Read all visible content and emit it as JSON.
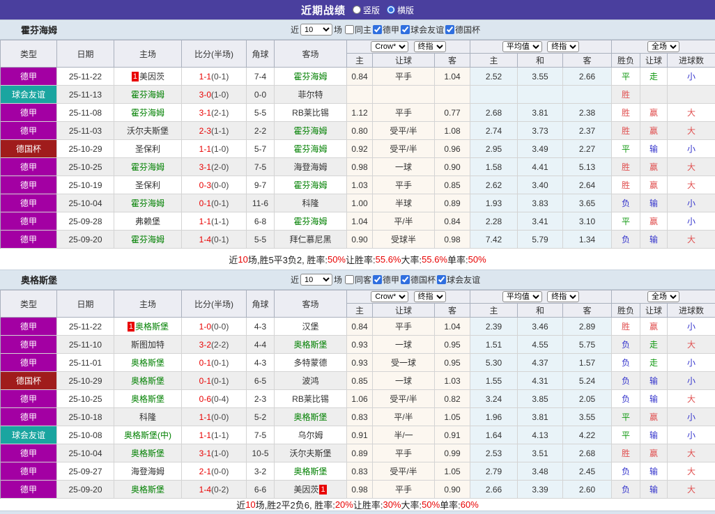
{
  "topbar": {
    "title": "近期战绩",
    "radios": [
      {
        "label": "竖版",
        "checked": false
      },
      {
        "label": "横版",
        "checked": true
      }
    ]
  },
  "colors": {
    "topbar_bg": "#4a3f9e",
    "league_badge": "#a300a3",
    "friendly_badge": "#1aa5a0",
    "cup_badge": "#a01c1c",
    "team_highlight_green": "#008000",
    "score_red": "#e80000",
    "result_red": "#e05050",
    "result_blue": "#3333cc",
    "result_green": "#119911",
    "odds_col_bg": "#fcf7f0",
    "avg_col_bg": "#e9f3f8",
    "strip_bg": "#dce6ef"
  },
  "columns": {
    "left": [
      "类型",
      "日期",
      "主场",
      "比分(半场)",
      "角球",
      "客场"
    ],
    "odds_selects": [
      "Crow*",
      "终指"
    ],
    "avg_selects": [
      "平均值",
      "终指"
    ],
    "scope_select": "全场",
    "sub": [
      "主",
      "让球",
      "客",
      "主",
      "和",
      "客",
      "胜负",
      "让球",
      "进球数"
    ]
  },
  "sections": [
    {
      "team": "霍芬海姆",
      "filter": {
        "prefix": "近",
        "count": "10",
        "suffix": "场",
        "checkboxes": [
          {
            "label": "同主",
            "checked": false
          },
          {
            "label": "德甲",
            "checked": true
          },
          {
            "label": "球会友谊",
            "checked": true
          },
          {
            "label": "德国杯",
            "checked": true
          }
        ]
      },
      "rows": [
        {
          "type": "德甲",
          "kind": "league",
          "date": "25-11-22",
          "home": {
            "name": "美因茨",
            "green": false,
            "badge": "1"
          },
          "score": "1-1",
          "half": "(0-1)",
          "corners": "7-4",
          "away": {
            "name": "霍芬海姆",
            "green": true
          },
          "odds": [
            "0.84",
            "平手",
            "1.04"
          ],
          "avg": [
            "2.52",
            "3.55",
            "2.66"
          ],
          "res": [
            [
              "平",
              "g"
            ],
            [
              "走",
              "g"
            ],
            [
              "小",
              "b"
            ]
          ]
        },
        {
          "type": "球会友谊",
          "kind": "friendly",
          "date": "25-11-13",
          "home": {
            "name": "霍芬海姆",
            "green": true
          },
          "score": "3-0",
          "half": "(1-0)",
          "corners": "0-0",
          "away": {
            "name": "菲尔特",
            "green": false
          },
          "odds": [
            "",
            "",
            ""
          ],
          "avg": [
            "",
            "",
            ""
          ],
          "res": [
            [
              "胜",
              "r"
            ],
            null,
            null
          ]
        },
        {
          "type": "德甲",
          "kind": "league",
          "date": "25-11-08",
          "home": {
            "name": "霍芬海姆",
            "green": true
          },
          "score": "3-1",
          "half": "(2-1)",
          "corners": "5-5",
          "away": {
            "name": "RB莱比锡",
            "green": false
          },
          "odds": [
            "1.12",
            "平手",
            "0.77"
          ],
          "avg": [
            "2.68",
            "3.81",
            "2.38"
          ],
          "res": [
            [
              "胜",
              "r"
            ],
            [
              "赢",
              "r"
            ],
            [
              "大",
              "r"
            ]
          ]
        },
        {
          "type": "德甲",
          "kind": "league",
          "date": "25-11-03",
          "home": {
            "name": "沃尔夫斯堡",
            "green": false
          },
          "score": "2-3",
          "half": "(1-1)",
          "corners": "2-2",
          "away": {
            "name": "霍芬海姆",
            "green": true
          },
          "odds": [
            "0.80",
            "受平/半",
            "1.08"
          ],
          "avg": [
            "2.74",
            "3.73",
            "2.37"
          ],
          "res": [
            [
              "胜",
              "r"
            ],
            [
              "赢",
              "r"
            ],
            [
              "大",
              "r"
            ]
          ]
        },
        {
          "type": "德国杯",
          "kind": "cup",
          "date": "25-10-29",
          "home": {
            "name": "圣保利",
            "green": false
          },
          "score": "1-1",
          "half": "(1-0)",
          "corners": "5-7",
          "away": {
            "name": "霍芬海姆",
            "green": true
          },
          "odds": [
            "0.92",
            "受平/半",
            "0.96"
          ],
          "avg": [
            "2.95",
            "3.49",
            "2.27"
          ],
          "res": [
            [
              "平",
              "g"
            ],
            [
              "输",
              "b"
            ],
            [
              "小",
              "b"
            ]
          ]
        },
        {
          "type": "德甲",
          "kind": "league",
          "date": "25-10-25",
          "home": {
            "name": "霍芬海姆",
            "green": true
          },
          "score": "3-1",
          "half": "(2-0)",
          "corners": "7-5",
          "away": {
            "name": "海登海姆",
            "green": false
          },
          "odds": [
            "0.98",
            "一球",
            "0.90"
          ],
          "avg": [
            "1.58",
            "4.41",
            "5.13"
          ],
          "res": [
            [
              "胜",
              "r"
            ],
            [
              "赢",
              "r"
            ],
            [
              "大",
              "r"
            ]
          ]
        },
        {
          "type": "德甲",
          "kind": "league",
          "date": "25-10-19",
          "home": {
            "name": "圣保利",
            "green": false
          },
          "score": "0-3",
          "half": "(0-0)",
          "corners": "9-7",
          "away": {
            "name": "霍芬海姆",
            "green": true
          },
          "odds": [
            "1.03",
            "平手",
            "0.85"
          ],
          "avg": [
            "2.62",
            "3.40",
            "2.64"
          ],
          "res": [
            [
              "胜",
              "r"
            ],
            [
              "赢",
              "r"
            ],
            [
              "大",
              "r"
            ]
          ]
        },
        {
          "type": "德甲",
          "kind": "league",
          "date": "25-10-04",
          "home": {
            "name": "霍芬海姆",
            "green": true
          },
          "score": "0-1",
          "half": "(0-1)",
          "corners": "11-6",
          "away": {
            "name": "科隆",
            "green": false
          },
          "odds": [
            "1.00",
            "半球",
            "0.89"
          ],
          "avg": [
            "1.93",
            "3.83",
            "3.65"
          ],
          "res": [
            [
              "负",
              "b"
            ],
            [
              "输",
              "b"
            ],
            [
              "小",
              "b"
            ]
          ]
        },
        {
          "type": "德甲",
          "kind": "league",
          "date": "25-09-28",
          "home": {
            "name": "弗赖堡",
            "green": false
          },
          "score": "1-1",
          "half": "(1-1)",
          "corners": "6-8",
          "away": {
            "name": "霍芬海姆",
            "green": true
          },
          "odds": [
            "1.04",
            "平/半",
            "0.84"
          ],
          "avg": [
            "2.28",
            "3.41",
            "3.10"
          ],
          "res": [
            [
              "平",
              "g"
            ],
            [
              "赢",
              "r"
            ],
            [
              "小",
              "b"
            ]
          ]
        },
        {
          "type": "德甲",
          "kind": "league",
          "date": "25-09-20",
          "home": {
            "name": "霍芬海姆",
            "green": true
          },
          "score": "1-4",
          "half": "(0-1)",
          "corners": "5-5",
          "away": {
            "name": "拜仁慕尼黑",
            "green": false
          },
          "odds": [
            "0.90",
            "受球半",
            "0.98"
          ],
          "avg": [
            "7.42",
            "5.79",
            "1.34"
          ],
          "res": [
            [
              "负",
              "b"
            ],
            [
              "输",
              "b"
            ],
            [
              "大",
              "r"
            ]
          ]
        }
      ],
      "summary": [
        {
          "t": "近",
          "red": false
        },
        {
          "t": "10",
          "red": true
        },
        {
          "t": "场,胜5平3负2, 胜率:",
          "red": false
        },
        {
          "t": "50%",
          "red": true
        },
        {
          "t": " 让胜率:",
          "red": false
        },
        {
          "t": "55.6%",
          "red": true
        },
        {
          "t": " 大率:",
          "red": false
        },
        {
          "t": "55.6%",
          "red": true
        },
        {
          "t": " 单率:",
          "red": false
        },
        {
          "t": "50%",
          "red": true
        }
      ]
    },
    {
      "team": "奥格斯堡",
      "filter": {
        "prefix": "近",
        "count": "10",
        "suffix": "场",
        "checkboxes": [
          {
            "label": "同客",
            "checked": false
          },
          {
            "label": "德甲",
            "checked": true
          },
          {
            "label": "德国杯",
            "checked": true
          },
          {
            "label": "球会友谊",
            "checked": true
          }
        ]
      },
      "rows": [
        {
          "type": "德甲",
          "kind": "league",
          "date": "25-11-22",
          "home": {
            "name": "奥格斯堡",
            "green": true,
            "badge": "1"
          },
          "score": "1-0",
          "half": "(0-0)",
          "corners": "4-3",
          "away": {
            "name": "汉堡",
            "green": false
          },
          "odds": [
            "0.84",
            "平手",
            "1.04"
          ],
          "avg": [
            "2.39",
            "3.46",
            "2.89"
          ],
          "res": [
            [
              "胜",
              "r"
            ],
            [
              "赢",
              "r"
            ],
            [
              "小",
              "b"
            ]
          ]
        },
        {
          "type": "德甲",
          "kind": "league",
          "date": "25-11-10",
          "home": {
            "name": "斯图加特",
            "green": false
          },
          "score": "3-2",
          "half": "(2-2)",
          "corners": "4-4",
          "away": {
            "name": "奥格斯堡",
            "green": true
          },
          "odds": [
            "0.93",
            "一球",
            "0.95"
          ],
          "avg": [
            "1.51",
            "4.55",
            "5.75"
          ],
          "res": [
            [
              "负",
              "b"
            ],
            [
              "走",
              "g"
            ],
            [
              "大",
              "r"
            ]
          ]
        },
        {
          "type": "德甲",
          "kind": "league",
          "date": "25-11-01",
          "home": {
            "name": "奥格斯堡",
            "green": true
          },
          "score": "0-1",
          "half": "(0-1)",
          "corners": "4-3",
          "away": {
            "name": "多特蒙德",
            "green": false
          },
          "odds": [
            "0.93",
            "受一球",
            "0.95"
          ],
          "avg": [
            "5.30",
            "4.37",
            "1.57"
          ],
          "res": [
            [
              "负",
              "b"
            ],
            [
              "走",
              "g"
            ],
            [
              "小",
              "b"
            ]
          ]
        },
        {
          "type": "德国杯",
          "kind": "cup",
          "date": "25-10-29",
          "home": {
            "name": "奥格斯堡",
            "green": true
          },
          "score": "0-1",
          "half": "(0-1)",
          "corners": "6-5",
          "away": {
            "name": "波鸿",
            "green": false
          },
          "odds": [
            "0.85",
            "一球",
            "1.03"
          ],
          "avg": [
            "1.55",
            "4.31",
            "5.24"
          ],
          "res": [
            [
              "负",
              "b"
            ],
            [
              "输",
              "b"
            ],
            [
              "小",
              "b"
            ]
          ]
        },
        {
          "type": "德甲",
          "kind": "league",
          "date": "25-10-25",
          "home": {
            "name": "奥格斯堡",
            "green": true
          },
          "score": "0-6",
          "half": "(0-4)",
          "corners": "2-3",
          "away": {
            "name": "RB莱比锡",
            "green": false
          },
          "odds": [
            "1.06",
            "受平/半",
            "0.82"
          ],
          "avg": [
            "3.24",
            "3.85",
            "2.05"
          ],
          "res": [
            [
              "负",
              "b"
            ],
            [
              "输",
              "b"
            ],
            [
              "大",
              "r"
            ]
          ]
        },
        {
          "type": "德甲",
          "kind": "league",
          "date": "25-10-18",
          "home": {
            "name": "科隆",
            "green": false
          },
          "score": "1-1",
          "half": "(0-0)",
          "corners": "5-2",
          "away": {
            "name": "奥格斯堡",
            "green": true
          },
          "odds": [
            "0.83",
            "平/半",
            "1.05"
          ],
          "avg": [
            "1.96",
            "3.81",
            "3.55"
          ],
          "res": [
            [
              "平",
              "g"
            ],
            [
              "赢",
              "r"
            ],
            [
              "小",
              "b"
            ]
          ]
        },
        {
          "type": "球会友谊",
          "kind": "friendly",
          "date": "25-10-08",
          "home": {
            "name": "奥格斯堡(中)",
            "green": true
          },
          "score": "1-1",
          "half": "(1-1)",
          "corners": "7-5",
          "away": {
            "name": "乌尔姆",
            "green": false
          },
          "odds": [
            "0.91",
            "半/一",
            "0.91"
          ],
          "avg": [
            "1.64",
            "4.13",
            "4.22"
          ],
          "res": [
            [
              "平",
              "g"
            ],
            [
              "输",
              "b"
            ],
            [
              "小",
              "b"
            ]
          ]
        },
        {
          "type": "德甲",
          "kind": "league",
          "date": "25-10-04",
          "home": {
            "name": "奥格斯堡",
            "green": true
          },
          "score": "3-1",
          "half": "(1-0)",
          "corners": "10-5",
          "away": {
            "name": "沃尔夫斯堡",
            "green": false
          },
          "odds": [
            "0.89",
            "平手",
            "0.99"
          ],
          "avg": [
            "2.53",
            "3.51",
            "2.68"
          ],
          "res": [
            [
              "胜",
              "r"
            ],
            [
              "赢",
              "r"
            ],
            [
              "大",
              "r"
            ]
          ]
        },
        {
          "type": "德甲",
          "kind": "league",
          "date": "25-09-27",
          "home": {
            "name": "海登海姆",
            "green": false
          },
          "score": "2-1",
          "half": "(0-0)",
          "corners": "3-2",
          "away": {
            "name": "奥格斯堡",
            "green": true
          },
          "odds": [
            "0.83",
            "受平/半",
            "1.05"
          ],
          "avg": [
            "2.79",
            "3.48",
            "2.45"
          ],
          "res": [
            [
              "负",
              "b"
            ],
            [
              "输",
              "b"
            ],
            [
              "大",
              "r"
            ]
          ]
        },
        {
          "type": "德甲",
          "kind": "league",
          "date": "25-09-20",
          "home": {
            "name": "奥格斯堡",
            "green": true
          },
          "score": "1-4",
          "half": "(0-2)",
          "corners": "6-6",
          "away": {
            "name": "美因茨",
            "green": false,
            "badge": "1",
            "badge_after": true
          },
          "odds": [
            "0.98",
            "平手",
            "0.90"
          ],
          "avg": [
            "2.66",
            "3.39",
            "2.60"
          ],
          "res": [
            [
              "负",
              "b"
            ],
            [
              "输",
              "b"
            ],
            [
              "大",
              "r"
            ]
          ]
        }
      ],
      "summary": [
        {
          "t": "近",
          "red": false
        },
        {
          "t": "10",
          "red": true
        },
        {
          "t": "场,胜2平2负6, 胜率:",
          "red": false
        },
        {
          "t": "20%",
          "red": true
        },
        {
          "t": " 让胜率:",
          "red": false
        },
        {
          "t": "30%",
          "red": true
        },
        {
          "t": " 大率:",
          "red": false
        },
        {
          "t": "50%",
          "red": true
        },
        {
          "t": " 单率:",
          "red": false
        },
        {
          "t": "60%",
          "red": true
        }
      ]
    }
  ]
}
